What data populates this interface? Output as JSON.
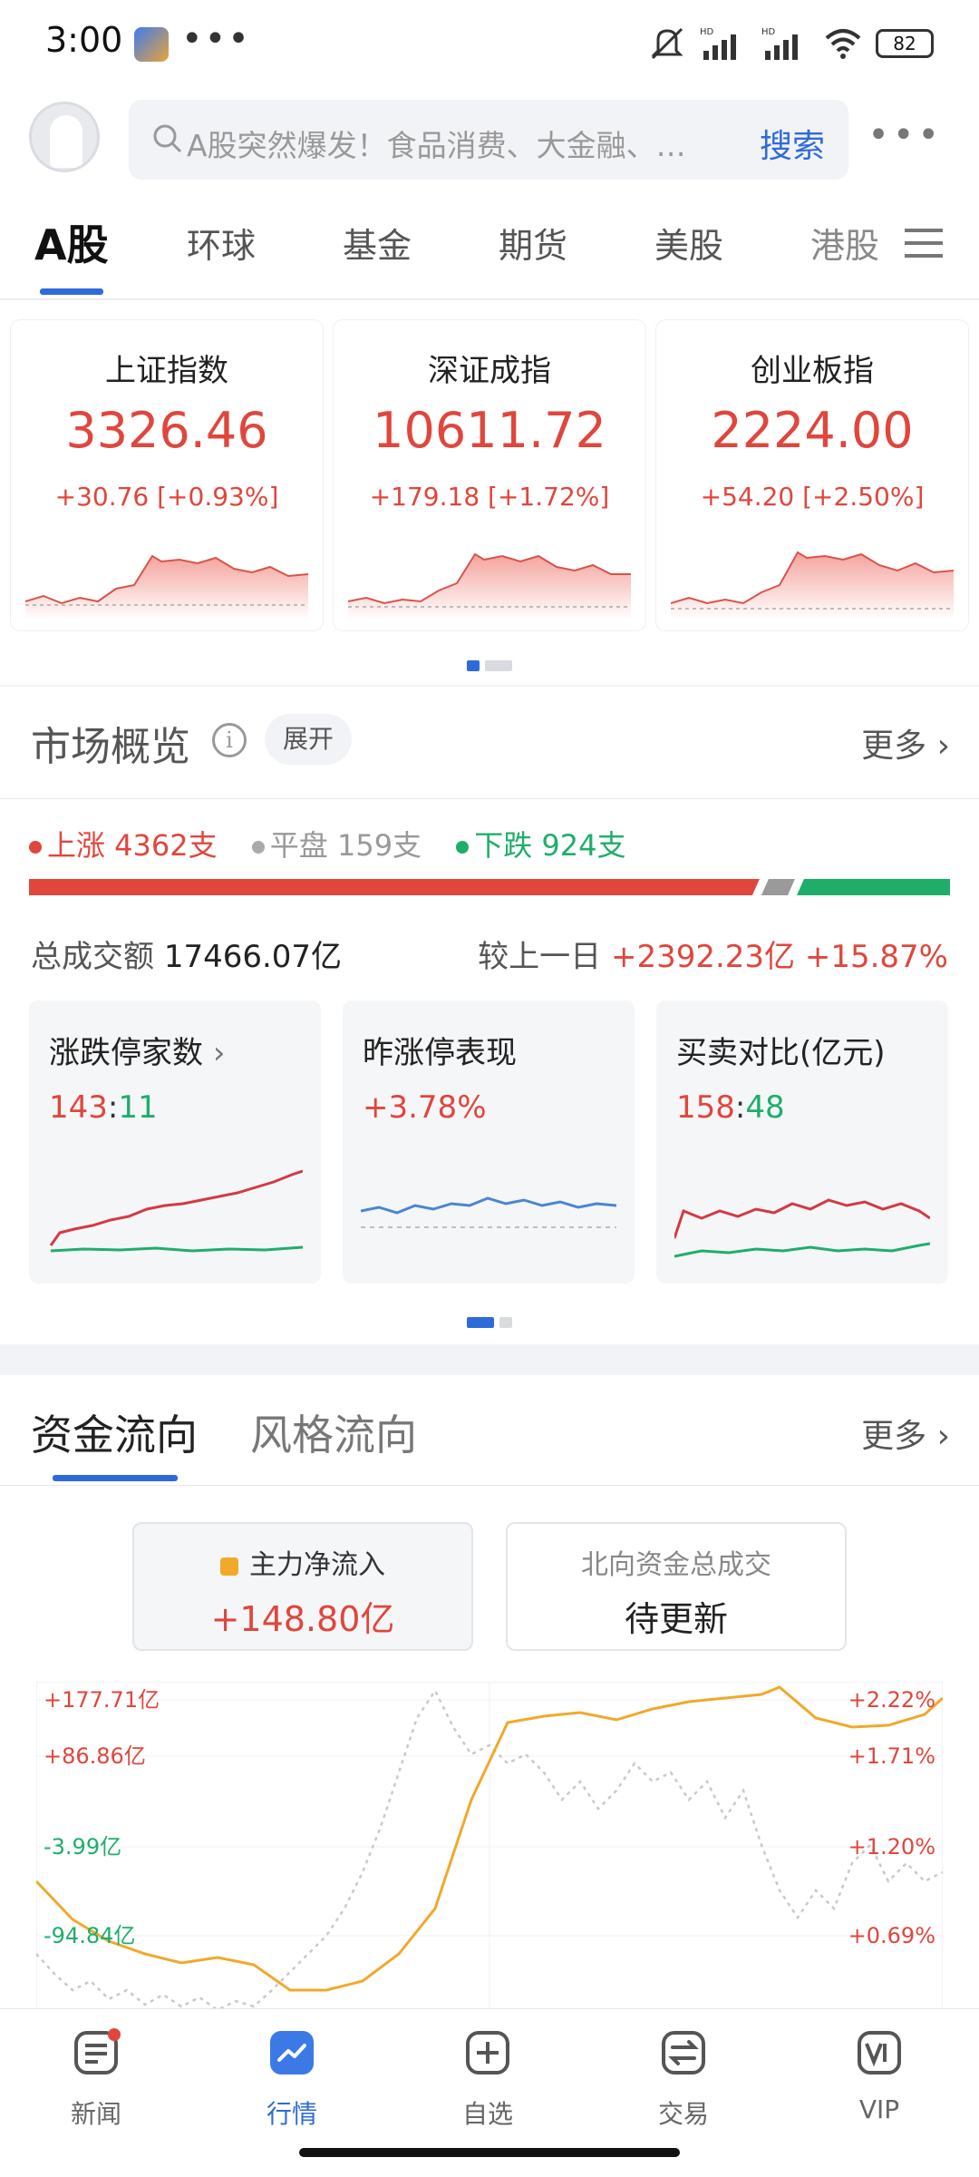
{
  "status": {
    "time": "3:00",
    "dots": "•••",
    "net1": "HD",
    "net2": "HD",
    "battery": "82"
  },
  "header": {
    "search_placeholder": "A股突然爆发！食品消费、大金融、…",
    "search_button": "搜索",
    "more": "•••"
  },
  "tabs": [
    {
      "label": "A股",
      "active": true
    },
    {
      "label": "环球"
    },
    {
      "label": "基金"
    },
    {
      "label": "期货"
    },
    {
      "label": "美股"
    },
    {
      "label": "港股"
    }
  ],
  "indices": [
    {
      "name": "上证指数",
      "value": "3326.46",
      "change": "+30.76 [+0.93%]"
    },
    {
      "name": "深证成指",
      "value": "10611.72",
      "change": "+179.18 [+1.72%]"
    },
    {
      "name": "创业板指",
      "value": "2224.00",
      "change": "+54.20 [+2.50%]"
    }
  ],
  "market": {
    "title": "市场概览",
    "info_icon": "i",
    "expand": "展开",
    "more": "更多",
    "up": "上涨 4362支",
    "flat": "平盘 159支",
    "down": "下跌 924支",
    "up_count": 4362,
    "flat_count": 159,
    "down_count": 924,
    "turnover_label": "总成交额",
    "turnover_value": "17466.07亿",
    "compare_label": "较上一日",
    "compare_value": "+2392.23亿 +15.87%",
    "cards": [
      {
        "title": "涨跌停家数",
        "value_a": "143",
        "sep": ":",
        "value_b": "11"
      },
      {
        "title": "昨涨停表现",
        "value": "+3.78%"
      },
      {
        "title": "买卖对比(亿元)",
        "value_a": "158",
        "sep": ":",
        "value_b": "48"
      }
    ]
  },
  "flow": {
    "tab1": "资金流向",
    "tab2": "风格流向",
    "more": "更多",
    "box1_label": "主力净流入",
    "box1_value": "+148.80亿",
    "box2_label": "北向资金总成交",
    "box2_value": "待更新",
    "left_ticks": [
      "+177.71亿",
      "+86.86亿",
      "-3.99亿",
      "-94.84亿"
    ],
    "right_ticks": [
      "+2.22%",
      "+1.71%",
      "+1.20%",
      "+0.69%"
    ]
  },
  "nav": [
    {
      "label": "新闻",
      "icon": "news-icon"
    },
    {
      "label": "行情",
      "icon": "market-icon",
      "active": true
    },
    {
      "label": "自选",
      "icon": "watchlist-icon"
    },
    {
      "label": "交易",
      "icon": "trade-icon"
    },
    {
      "label": "VIP",
      "icon": "vip-icon"
    }
  ],
  "colors": {
    "up": "#e0463c",
    "down": "#1fae6a",
    "accent": "#2f6bd8",
    "flow_line": "#f0a92a"
  }
}
